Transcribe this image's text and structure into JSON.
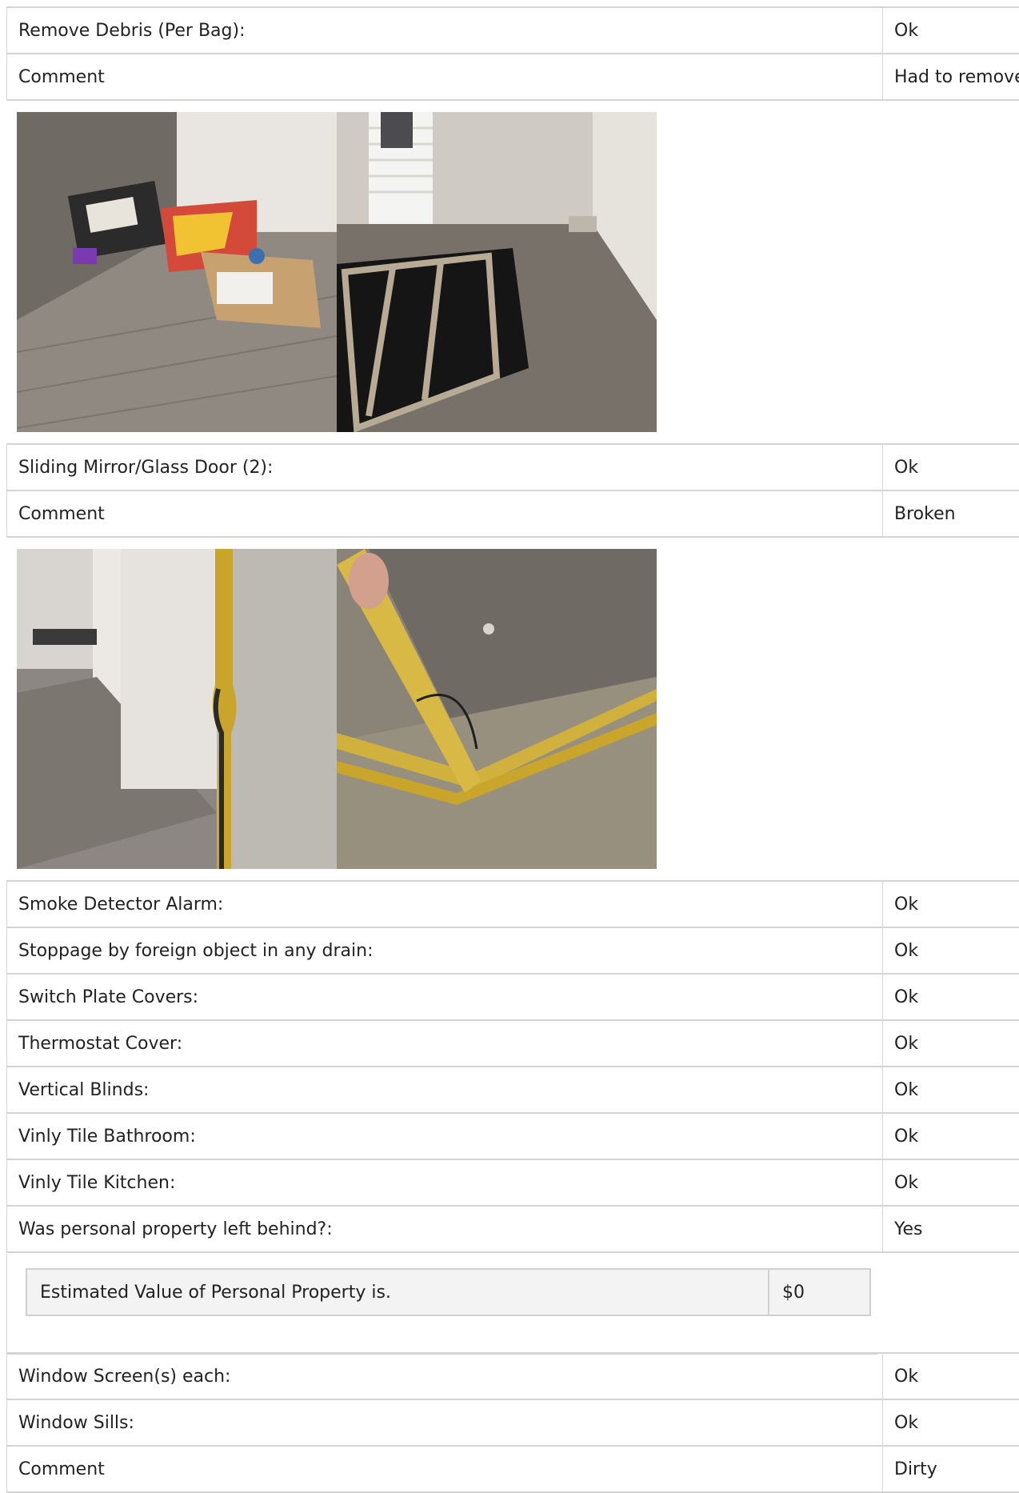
{
  "section1": {
    "rows": [
      {
        "label": "Remove Debris (Per Bag):",
        "value": "Ok"
      },
      {
        "label": "Comment",
        "value": "Had to remove"
      }
    ],
    "photos": [
      "debris-photo",
      "bedroom-photo"
    ]
  },
  "section2": {
    "rows": [
      {
        "label": "Sliding Mirror/Glass Door (2):",
        "value": "Ok"
      },
      {
        "label": "Comment",
        "value": "Broken"
      }
    ],
    "photos": [
      "door-frame-photo",
      "mirror-track-photo"
    ]
  },
  "section3": {
    "rows": [
      {
        "label": "Smoke Detector Alarm:",
        "value": "Ok"
      },
      {
        "label": "Stoppage by foreign object in any drain:",
        "value": "Ok"
      },
      {
        "label": "Switch Plate Covers:",
        "value": "Ok"
      },
      {
        "label": "Thermostat Cover:",
        "value": "Ok"
      },
      {
        "label": "Vertical Blinds:",
        "value": "Ok"
      },
      {
        "label": "Vinly Tile Bathroom:",
        "value": "Ok"
      },
      {
        "label": "Vinly Tile Kitchen:",
        "value": "Ok"
      },
      {
        "label": "Was personal property left behind?:",
        "value": "Yes"
      }
    ]
  },
  "personal_property": {
    "label": "Estimated Value of Personal Property is.",
    "value": "$0"
  },
  "section4": {
    "rows": [
      {
        "label": "Window Screen(s) each:",
        "value": "Ok"
      },
      {
        "label": "Window Sills:",
        "value": "Ok"
      },
      {
        "label": "Comment",
        "value": "Dirty"
      }
    ]
  }
}
